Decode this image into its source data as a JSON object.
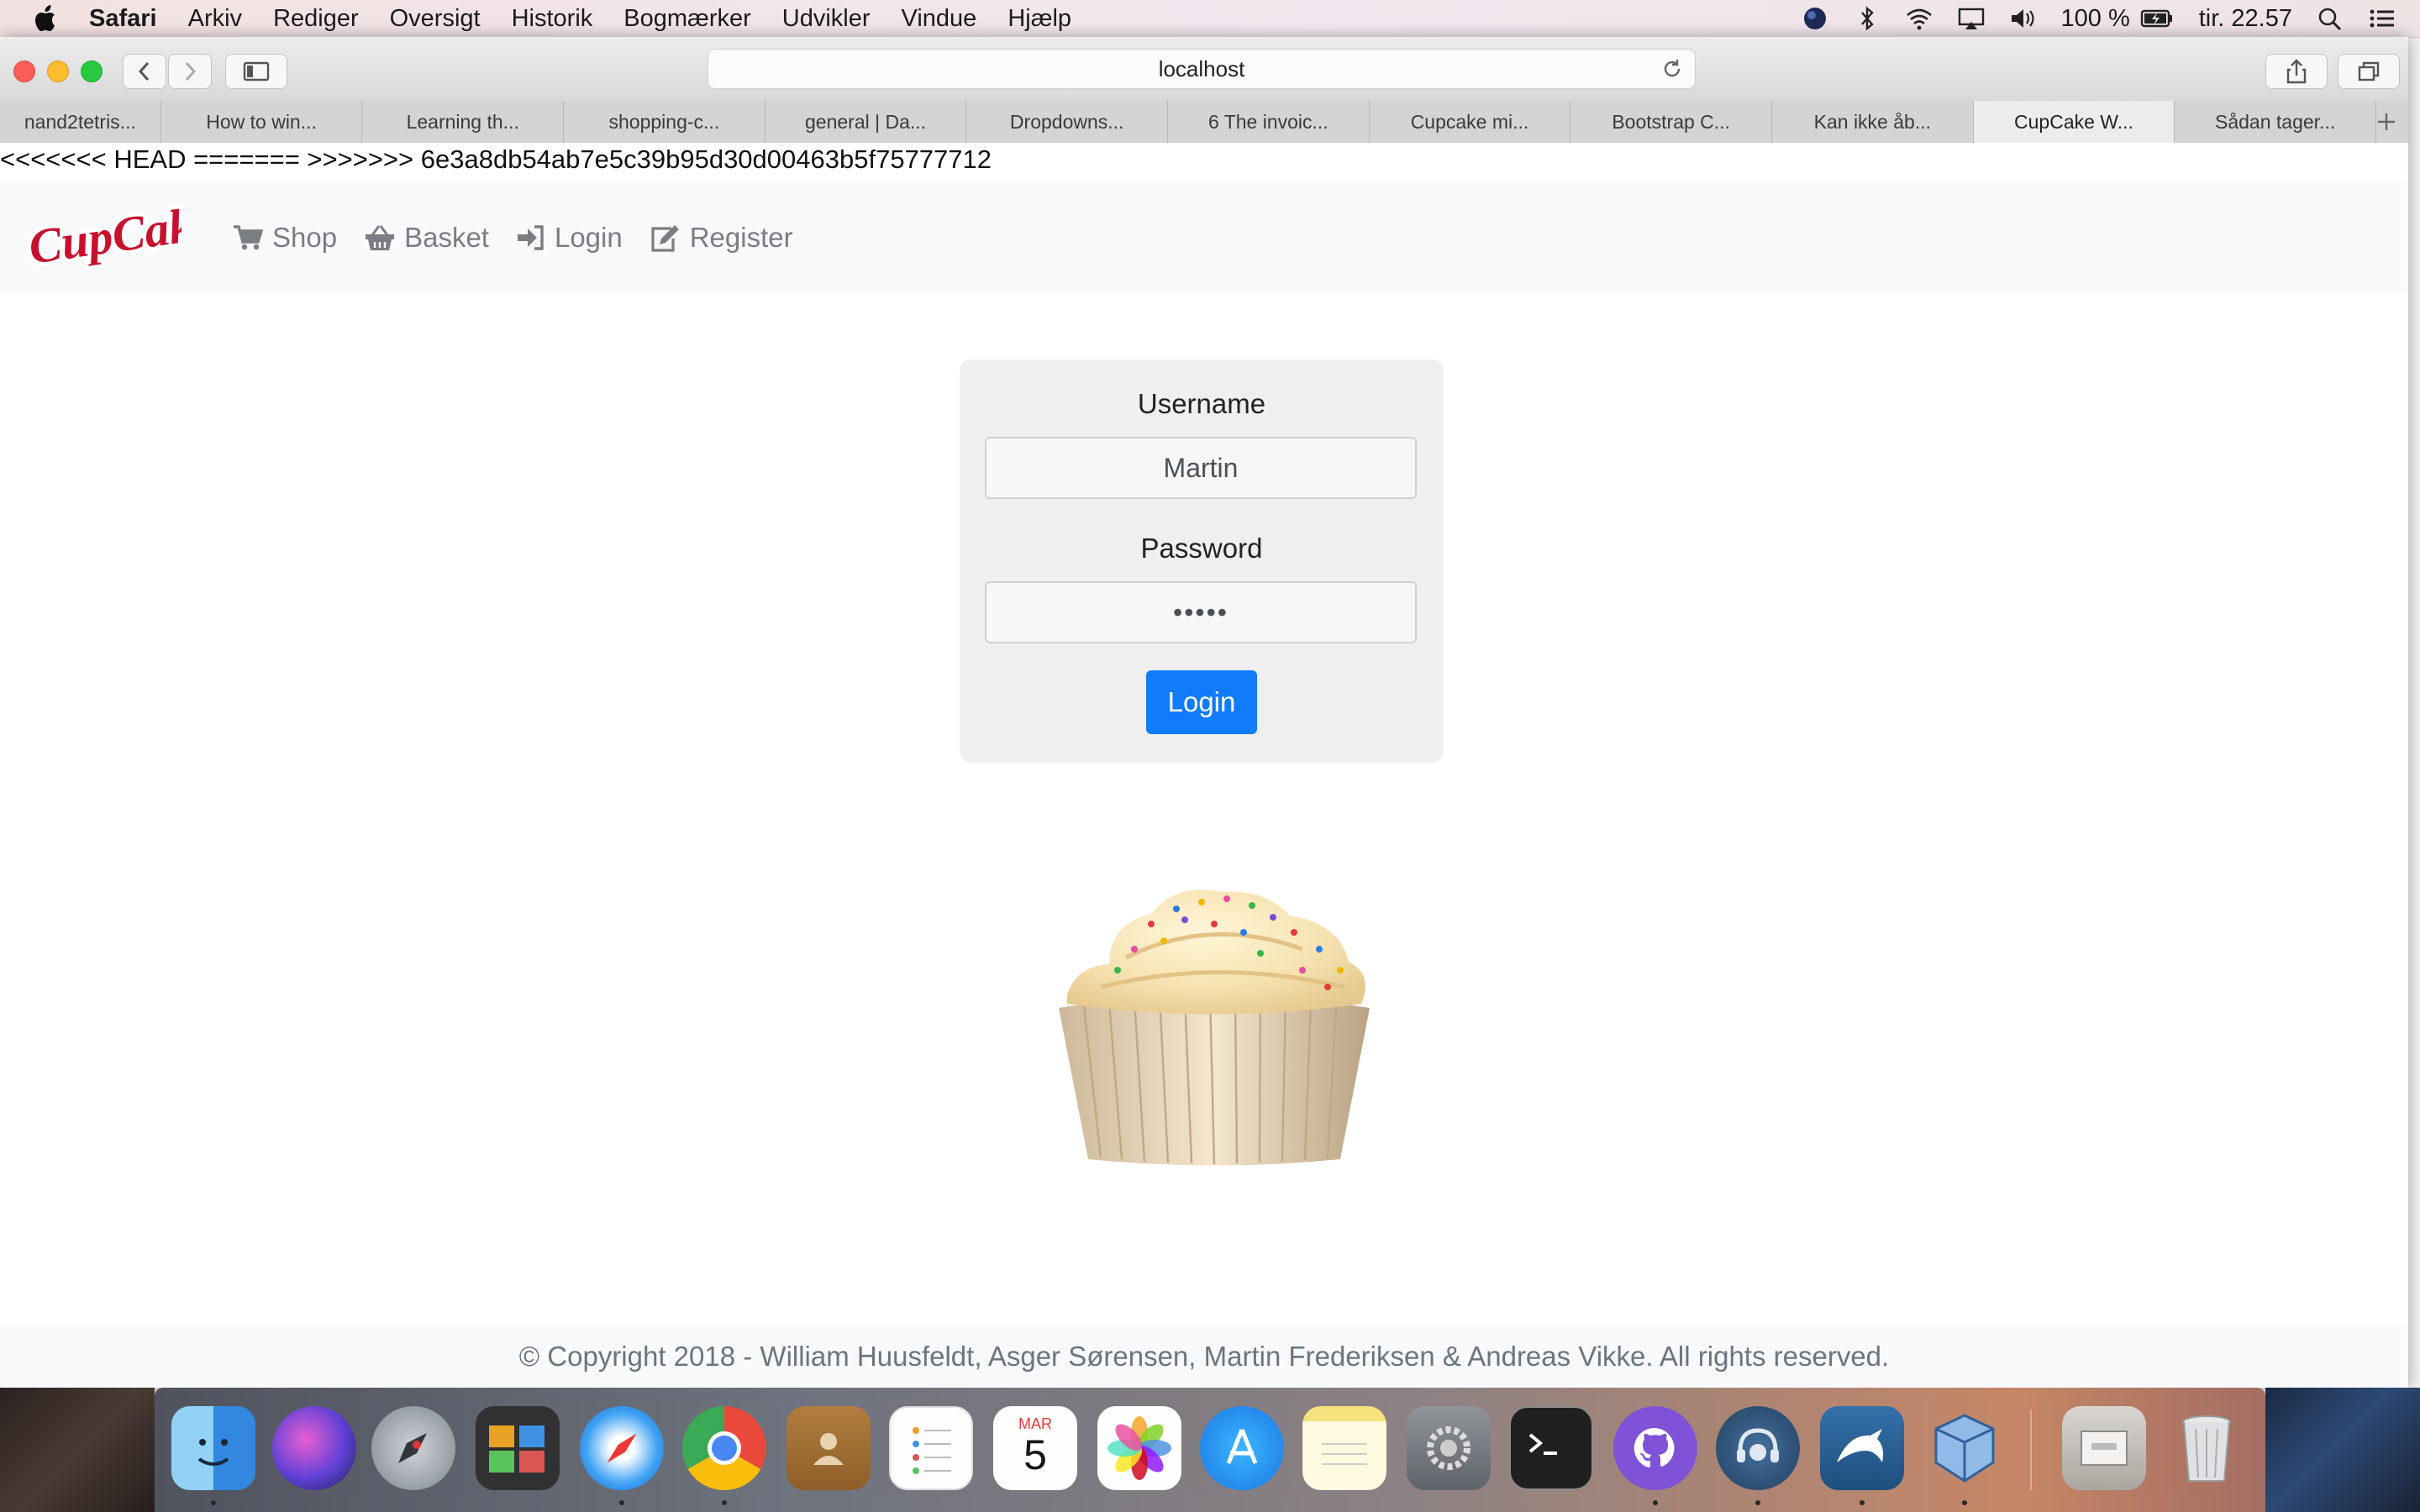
{
  "menubar": {
    "app": "Safari",
    "items": [
      "Arkiv",
      "Rediger",
      "Oversigt",
      "Historik",
      "Bogmærker",
      "Udvikler",
      "Vindue",
      "Hjælp"
    ],
    "battery": "100 %",
    "clock": "tir. 22.57"
  },
  "browser": {
    "address": "localhost",
    "tabs": [
      "nand2tetris...",
      "How to win...",
      "Learning th...",
      "shopping-c...",
      "general | Da...",
      "Dropdowns...",
      "6 The invoic...",
      "Cupcake mi...",
      "Bootstrap C...",
      "Kan ikke åb...",
      "CupCake W...",
      "Sådan tager..."
    ],
    "active_tab_index": 10
  },
  "page": {
    "conflict_text": "<<<<<<< HEAD ======= >>>>>>> 6e3a8db54ab7e5c39b95d30d00463b5f75777712",
    "brand": "CupCakes",
    "nav": {
      "shop": "Shop",
      "basket": "Basket",
      "login": "Login",
      "register": "Register"
    },
    "form": {
      "username_label": "Username",
      "username_value": "Martin",
      "password_label": "Password",
      "password_value": "•••••",
      "submit": "Login"
    },
    "footer": "© Copyright 2018 - William Huusfeldt, Asger Sørensen, Martin Frederiksen & Andreas Vikke. All rights reserved."
  },
  "dock": {
    "apps": [
      "finder-icon",
      "siri-icon",
      "launchpad-icon",
      "photo-booth-icon",
      "safari-icon",
      "chrome-icon",
      "contacts-icon",
      "reminders-icon",
      "calendar-icon",
      "photos-icon",
      "app-store-icon",
      "notes-icon",
      "system-preferences-icon",
      "terminal-icon",
      "github-desktop-icon",
      "teamspeak-icon",
      "mysql-workbench-icon",
      "virtualbox-icon",
      "downloads-icon",
      "trash-icon"
    ],
    "calendar_month": "MAR",
    "calendar_day": "5"
  },
  "colors": {
    "primary": "#117cfb",
    "nav_text": "#7a7d81",
    "brand_red": "#c8102e"
  }
}
